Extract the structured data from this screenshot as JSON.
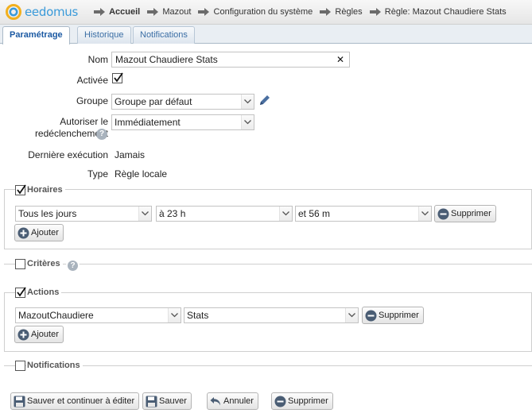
{
  "header": {
    "logo_text": "eedomus",
    "breadcrumbs": [
      "Accueil",
      "Mazout",
      "Configuration du système",
      "Règles",
      "Règle: Mazout Chaudiere Stats"
    ]
  },
  "tabs": [
    "Paramétrage",
    "Historique",
    "Notifications"
  ],
  "form": {
    "nom_label": "Nom",
    "nom_value": "Mazout Chaudiere Stats",
    "clear_glyph": "✕",
    "activee_label": "Activée",
    "activee_checked": true,
    "groupe_label": "Groupe",
    "groupe_value": "Groupe par défaut",
    "autoriser_label_1": "Autoriser le",
    "autoriser_label_2": "redéclenchement",
    "autoriser_value": "Immédiatement",
    "derniere_label": "Dernière exécution",
    "derniere_value": "Jamais",
    "type_label": "Type",
    "type_value": "Règle locale",
    "help_glyph": "?"
  },
  "horaires": {
    "title": "Horaires",
    "checked": true,
    "day_value": "Tous les jours",
    "hour_value": "à 23 h",
    "minute_value": "et 56 m",
    "delete_label": "Supprimer",
    "add_label": "Ajouter"
  },
  "criteres": {
    "title": "Critères",
    "checked": false
  },
  "actions": {
    "title": "Actions",
    "checked": true,
    "device_value": "MazoutChaudiere",
    "action_value": "Stats",
    "delete_label": "Supprimer",
    "add_label": "Ajouter"
  },
  "notifications_section": {
    "title": "Notifications",
    "checked": false
  },
  "footer": {
    "save_continue_label": "Sauver et continuer à éditer",
    "save_label": "Sauver",
    "cancel_label": "Annuler",
    "delete_label": "Supprimer"
  },
  "colors": {
    "brand": "#3a9ad9",
    "tab_text": "#3b6ea5",
    "icon_blue": "#4a6fa0"
  }
}
